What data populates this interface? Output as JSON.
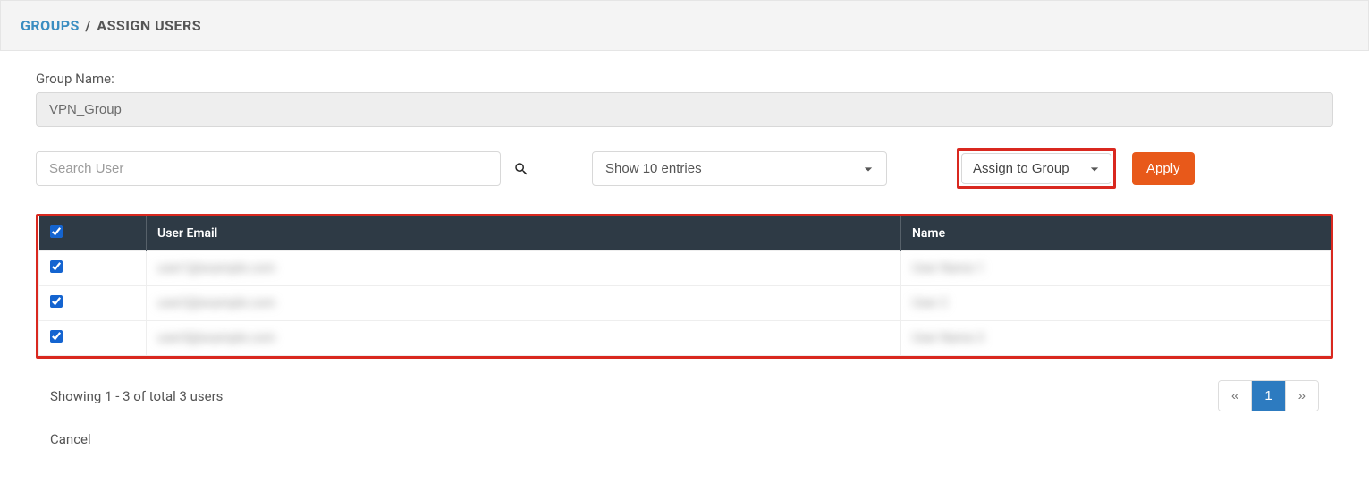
{
  "breadcrumb": {
    "link": "GROUPS",
    "sep": "/",
    "current": "ASSIGN USERS"
  },
  "group_name_label": "Group Name:",
  "group_name_value": "VPN_Group",
  "search": {
    "placeholder": "Search User"
  },
  "entries": {
    "selected": "Show 10 entries"
  },
  "assign": {
    "selected": "Assign to Group"
  },
  "apply_label": "Apply",
  "table": {
    "headers": {
      "email": "User Email",
      "name": "Name"
    },
    "select_all": true,
    "rows": [
      {
        "checked": true,
        "email": "user1@example.com",
        "name": "User Name 1"
      },
      {
        "checked": true,
        "email": "user2@example.com",
        "name": "User 2"
      },
      {
        "checked": true,
        "email": "user3@example.com",
        "name": "User Name 3"
      }
    ]
  },
  "showing_text": "Showing 1 - 3 of total 3 users",
  "pager": {
    "prev": "«",
    "page": "1",
    "next": "»"
  },
  "cancel_label": "Cancel"
}
